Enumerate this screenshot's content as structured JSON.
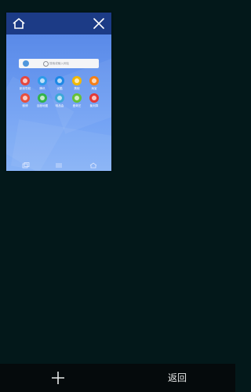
{
  "tab": {
    "title_icons": {
      "home": "home-icon",
      "close": "close-icon"
    },
    "search_placeholder": "搜索或输入网址",
    "shortcuts": [
      {
        "label": "新浪导航",
        "color": "#e4473f",
        "icon": "sina-icon"
      },
      {
        "label": "腾讯",
        "color": "#2f9be9",
        "icon": "tencent-icon"
      },
      {
        "label": "优酷",
        "color": "#1e88e5",
        "icon": "youku-icon"
      },
      {
        "label": "携程",
        "color": "#f2b800",
        "icon": "ctrip-icon"
      },
      {
        "label": "淘宝",
        "color": "#f57f17",
        "icon": "taobao-icon"
      },
      {
        "label": "微博",
        "color": "#e84f3c",
        "icon": "weibo-icon"
      },
      {
        "label": "百度地图",
        "color": "#32b34a",
        "icon": "baidu-map-icon"
      },
      {
        "label": "唯品会",
        "color": "#3ea7d8",
        "icon": "vip-icon"
      },
      {
        "label": "爱奇艺",
        "color": "#66c136",
        "icon": "iqiyi-icon"
      },
      {
        "label": "聚划算",
        "color": "#e53935",
        "icon": "juhuasuan-icon"
      }
    ]
  },
  "bottom_bar": {
    "new_tab_icon": "plus-icon",
    "back_label": "返回"
  }
}
